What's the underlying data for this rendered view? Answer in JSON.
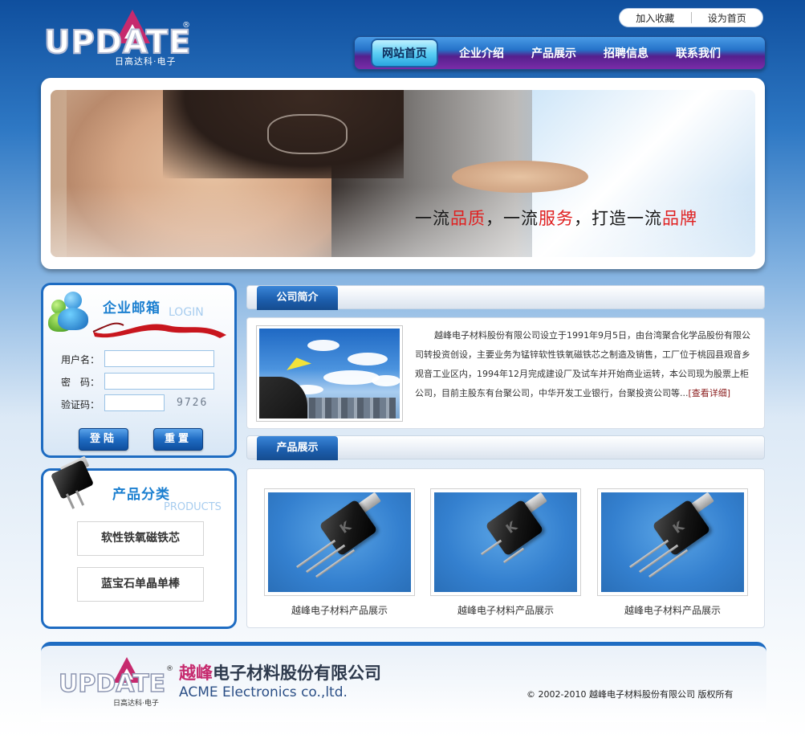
{
  "header": {
    "logo_text": "UPDATE",
    "logo_sub": "日高达科·电子",
    "logo_reg": "®",
    "top_links": [
      "加入收藏",
      "设为首页"
    ],
    "nav": [
      "网站首页",
      "企业介绍",
      "产品展示",
      "招聘信息",
      "联系我们"
    ],
    "nav_active_index": 0
  },
  "banner": {
    "slogan_parts": [
      "一流",
      "品质",
      "，一流",
      "服务",
      "，打造一流",
      "品牌"
    ]
  },
  "login": {
    "title": "企业邮箱",
    "title_en": "LOGIN",
    "username_label": "用户名：",
    "password_label": "密　码：",
    "captcha_label": "验证码：",
    "captcha_value": "9726",
    "login_button": "登陆",
    "reset_button": "重置"
  },
  "category": {
    "title": "产品分类",
    "title_en": "PRODUCTS",
    "items": [
      "软性铁氧磁铁芯",
      "蓝宝石单晶单棒"
    ]
  },
  "about": {
    "heading": "公司简介",
    "text": "越峰电子材料股份有限公司设立于1991年9月5日，由台湾聚合化学品股份有限公司转投资创设，主要业务为锰锌软性铁氧磁铁芯之制造及销售，工厂位于桃园县观音乡观音工业区内，1994年12月完成建设厂及试车并开始商业运转，本公司现为股票上柜公司，目前主股东有台聚公司，中华开发工业银行，台聚投资公司等...",
    "more": "[查看详细]"
  },
  "products": {
    "heading": "产品展示",
    "items": [
      {
        "caption": "越峰电子材料产品展示"
      },
      {
        "caption": "越峰电子材料产品展示"
      },
      {
        "caption": "越峰电子材料产品展示"
      }
    ]
  },
  "footer": {
    "company_name_pink": "越峰",
    "company_name_rest": "电子材料股份有限公司",
    "company_en": "ACME Electronics co.,ltd.",
    "copyright": "© 2002-2010  越峰电子材料股份有限公司  版权所有"
  },
  "colors": {
    "brand_blue": "#1e6cc2",
    "brand_pink": "#c62a6e",
    "slogan_red": "#e02020"
  }
}
